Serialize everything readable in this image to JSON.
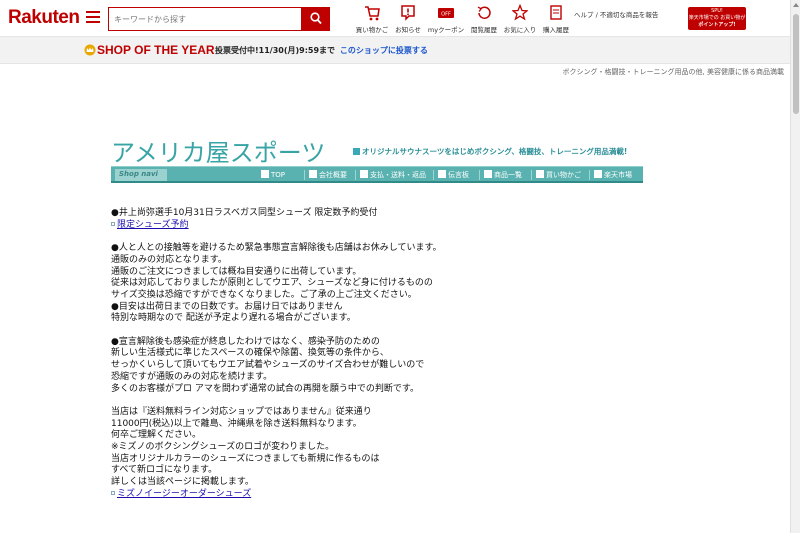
{
  "header": {
    "logo": "Rakuten",
    "search_placeholder": "キーワードから探す",
    "items": [
      {
        "label": "買い物かご",
        "icon": "cart-icon"
      },
      {
        "label": "お知らせ",
        "icon": "notice-icon"
      },
      {
        "label": "myクーポン",
        "icon": "coupon-icon"
      },
      {
        "label": "閲覧履歴",
        "icon": "history-icon"
      },
      {
        "label": "お気に入り",
        "icon": "star-icon"
      },
      {
        "label": "購入履歴",
        "icon": "purchase-history-icon"
      }
    ],
    "links": "ヘルプ / 不適切な商品を報告",
    "promo": {
      "line1": "SPU!",
      "line2": "楽天市場での お買い物が",
      "line3": "ポイントアップ!"
    }
  },
  "banner": {
    "title": "SHOP OF THE YEAR",
    "vote_text": "投票受付中!11/30(月)9:59まで",
    "vote_link": "このショップに投票する"
  },
  "breadcrumb": "ボクシング・格闘技・トレーニング用品の他, 美容健康に係る商品満載",
  "shop": {
    "title": "アメリカ屋スポーツ",
    "tagline": "オリジナルサウナスーツをはじめボクシング、格闘技、トレーニング用品満載!",
    "nav_label": "Shop navi",
    "nav": [
      "TOP",
      "会社概要",
      "支払・送料・返品",
      "伝言板",
      "商品一覧",
      "買い物かご",
      "楽天市場"
    ]
  },
  "content": {
    "l1": "●井上尚弥選手10月31日ラスベガス同型シューズ 限定数予約受付",
    "link1": "限定シューズ予約",
    "l2": "●人と人との接触等を避けるため緊急事態宣言解除後も店舗はお休みしています。",
    "l3": "通販のみの対応となります。",
    "l4": "通販のご注文につきましては概ね目安通りに出荷しています。",
    "l5": "従来は対応しておりましたが原則としてウエア、シューズなど身に付けるものの",
    "l6": "サイズ交換は恐縮ですができなくなりました。ご了承の上ご注文ください。",
    "l7": "●目安は出荷日までの日数です。お届け日ではありません",
    "l8": "特別な時期なので 配送が予定より遅れる場合がございます。",
    "l9": "●宣言解除後も感染症が終息したわけではなく、感染予防のための",
    "l10": "新しい生活様式に準じたスペースの確保や除菌、換気等の条件から、",
    "l11": "せっかくいらして頂いてもウエア試着やシューズのサイズ合わせが難しいので",
    "l12": "恐縮ですが通販のみの対応を続けます。",
    "l13": "多くのお客様がプロ アマを問わず通常の試合の再開を願う中での判断です。",
    "l14": "当店は『送料無料ライン対応ショップではありません』従来通り",
    "l15": "11000円(税込)以上で離島、沖縄県を除き送料無料なります。",
    "l16": "何卒ご理解ください。",
    "l17": "※ミズノのボクシングシューズのロゴが変わりました。",
    "l18": "当店オリジナルカラーのシューズにつきましても新規に作るものは",
    "l19": "すべて新ロゴになります。",
    "l20": "詳しくは当該ページに掲載します。",
    "link2": "ミズノイージーオーダーシューズ"
  }
}
